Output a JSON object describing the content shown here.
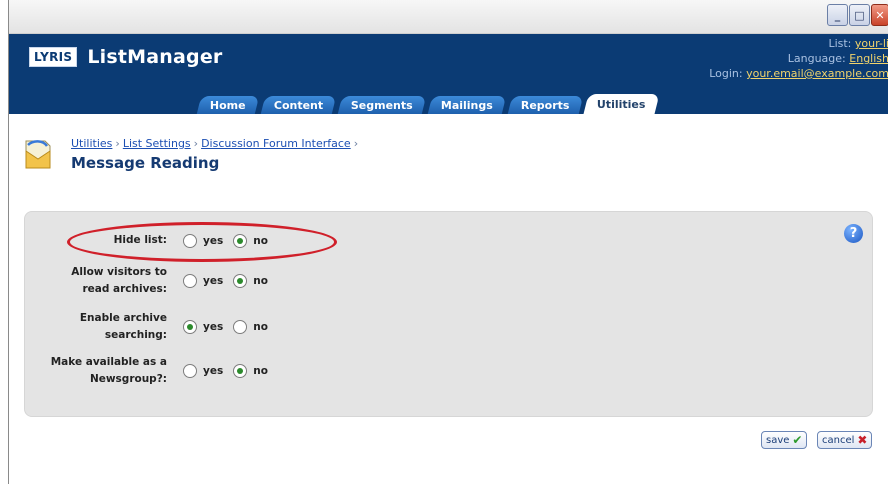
{
  "window": {
    "minimize_icon": "minimize-icon",
    "maximize_icon": "maximize-icon",
    "close_icon": "close-icon"
  },
  "header": {
    "logo_mark": "LYRIS",
    "app_name": "ListManager",
    "list_label": "List:",
    "list_value": "your-li",
    "language_label": "Language:",
    "language_value": "English",
    "login_label": "Login:",
    "login_value": "your.email@example.com"
  },
  "tabs": [
    {
      "label": "Home",
      "active": false
    },
    {
      "label": "Content",
      "active": false
    },
    {
      "label": "Segments",
      "active": false
    },
    {
      "label": "Mailings",
      "active": false
    },
    {
      "label": "Reports",
      "active": false
    },
    {
      "label": "Utilities",
      "active": true
    }
  ],
  "breadcrumb": {
    "items": [
      "Utilities",
      "List Settings",
      "Discussion Forum Interface"
    ],
    "separator": "›"
  },
  "page_title": "Message Reading",
  "form": {
    "rows": [
      {
        "label": "Hide list:",
        "selected": "no"
      },
      {
        "label": "Allow visitors to read archives:",
        "selected": "no"
      },
      {
        "label": "Enable archive searching:",
        "selected": "yes"
      },
      {
        "label": "Make available as a Newsgroup?:",
        "selected": "no"
      }
    ],
    "yes_label": "yes",
    "no_label": "no"
  },
  "actions": {
    "save_label": "save",
    "cancel_label": "cancel"
  },
  "colors": {
    "header_bg": "#0b3b74",
    "panel_bg": "#e4e4e4",
    "highlight": "#d0202a"
  }
}
